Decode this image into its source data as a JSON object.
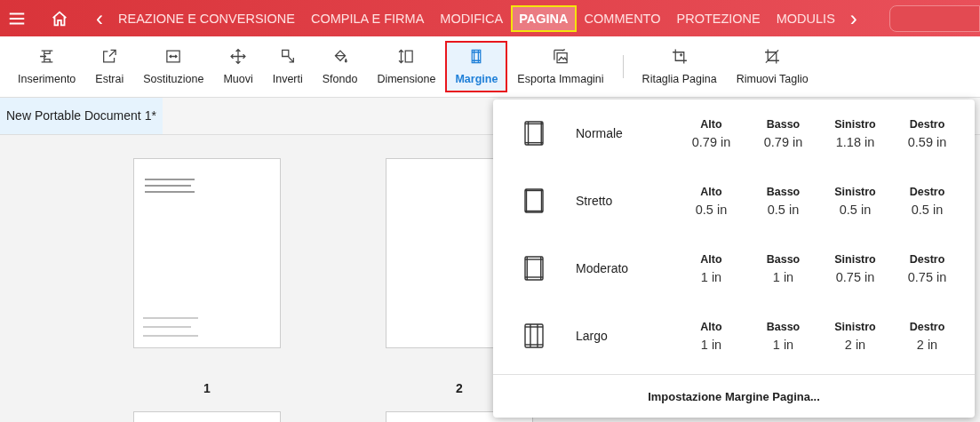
{
  "nav_tabs": [
    {
      "label": "REAZIONE E CONVERSIONE",
      "selected": false
    },
    {
      "label": "COMPILA E FIRMA",
      "selected": false
    },
    {
      "label": "MODIFICA",
      "selected": false
    },
    {
      "label": "PAGINA",
      "selected": true
    },
    {
      "label": "COMMENTO",
      "selected": false
    },
    {
      "label": "PROTEZIONE",
      "selected": false
    },
    {
      "label": "MODULIS",
      "selected": false
    }
  ],
  "nav_arrows": {
    "prev": "‹",
    "next": "›"
  },
  "tools": [
    {
      "label": "Inserimento",
      "selected": false
    },
    {
      "label": "Estrai",
      "selected": false
    },
    {
      "label": "Sostituzione",
      "selected": false
    },
    {
      "label": "Muovi",
      "selected": false
    },
    {
      "label": "Inverti",
      "selected": false
    },
    {
      "label": "Sfondo",
      "selected": false
    },
    {
      "label": "Dimensione",
      "selected": false
    },
    {
      "label": "Margine",
      "selected": true
    },
    {
      "label": "Esporta Immagini",
      "selected": false
    },
    {
      "label": "Ritaglia Pagina",
      "selected": false
    },
    {
      "label": "Rimuovi Taglio",
      "selected": false
    }
  ],
  "document_tab": {
    "title": "New Portable Document 1*",
    "selected": true
  },
  "pages": [
    {
      "number": "1"
    },
    {
      "number": "2"
    }
  ],
  "margin_menu": {
    "presets": [
      {
        "name": "Normale",
        "margins": [
          {
            "label": "Alto",
            "value": "0.79 in"
          },
          {
            "label": "Basso",
            "value": "0.79 in"
          },
          {
            "label": "Sinistro",
            "value": "1.18 in"
          },
          {
            "label": "Destro",
            "value": "0.59 in"
          }
        ]
      },
      {
        "name": "Stretto",
        "margins": [
          {
            "label": "Alto",
            "value": "0.5 in"
          },
          {
            "label": "Basso",
            "value": "0.5 in"
          },
          {
            "label": "Sinistro",
            "value": "0.5 in"
          },
          {
            "label": "Destro",
            "value": "0.5 in"
          }
        ]
      },
      {
        "name": "Moderato",
        "margins": [
          {
            "label": "Alto",
            "value": "1 in"
          },
          {
            "label": "Basso",
            "value": "1 in"
          },
          {
            "label": "Sinistro",
            "value": "0.75 in"
          },
          {
            "label": "Destro",
            "value": "0.75 in"
          }
        ]
      },
      {
        "name": "Largo",
        "margins": [
          {
            "label": "Alto",
            "value": "1 in"
          },
          {
            "label": "Basso",
            "value": "1 in"
          },
          {
            "label": "Sinistro",
            "value": "2 in"
          },
          {
            "label": "Destro",
            "value": "2 in"
          }
        ]
      }
    ],
    "custom": "Impostazione Margine Pagina..."
  }
}
